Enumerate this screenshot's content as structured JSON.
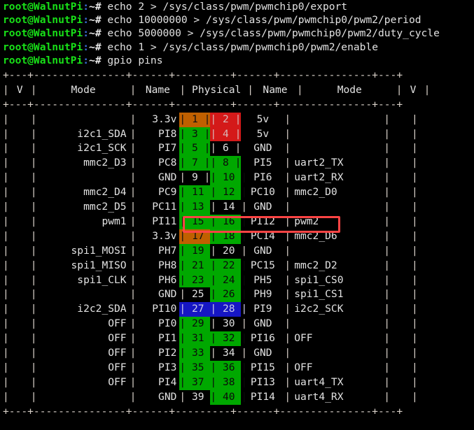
{
  "terminal": {
    "prompt": {
      "user_host": "root@WalnutPi",
      "colon": ":",
      "path": "~",
      "sigil": "#"
    },
    "commands": [
      "echo 2 > /sys/class/pwm/pwmchip0/export",
      "echo 10000000 > /sys/class/pwm/pwmchip0/pwm2/period",
      "echo 5000000 > /sys/class/pwm/pwmchip0/pwm2/duty_cycle",
      "echo 1 > /sys/class/pwm/pwmchip0/pwm2/enable",
      "gpio pins"
    ]
  },
  "gpio_table": {
    "separator": "+---+---------------+------+---------+------+---------------+---+",
    "headers": {
      "v_left": "V",
      "mode_left": "Mode",
      "name_left": "Name",
      "physical": "Physical",
      "name_right": "Name",
      "mode_right": "Mode",
      "v_right": "V"
    },
    "colors": {
      "green": "#00a800",
      "red": "#d41919",
      "orange": "#c06000",
      "blue": "#1616c4",
      "black": "#000000",
      "highlight": "#ff4444"
    },
    "rows": [
      {
        "v_left": "",
        "mode_left": "",
        "name_left": "3.3v",
        "pin_left": "1",
        "pin_left_color": "orange",
        "pin_right": "2",
        "pin_right_color": "red",
        "name_right": "5v",
        "mode_right": "",
        "v_right": ""
      },
      {
        "v_left": "",
        "mode_left": "i2c1_SDA",
        "name_left": "PI8",
        "pin_left": "3",
        "pin_left_color": "green",
        "pin_right": "4",
        "pin_right_color": "red",
        "name_right": "5v",
        "mode_right": "",
        "v_right": ""
      },
      {
        "v_left": "",
        "mode_left": "i2c1_SCK",
        "name_left": "PI7",
        "pin_left": "5",
        "pin_left_color": "green",
        "pin_right": "6",
        "pin_right_color": "black",
        "name_right": "GND",
        "mode_right": "",
        "v_right": ""
      },
      {
        "v_left": "",
        "mode_left": "mmc2_D3",
        "name_left": "PC8",
        "pin_left": "7",
        "pin_left_color": "green",
        "pin_right": "8",
        "pin_right_color": "green",
        "name_right": "PI5",
        "mode_right": "uart2_TX",
        "v_right": ""
      },
      {
        "v_left": "",
        "mode_left": "",
        "name_left": "GND",
        "pin_left": "9",
        "pin_left_color": "black",
        "pin_right": "10",
        "pin_right_color": "green",
        "name_right": "PI6",
        "mode_right": "uart2_RX",
        "v_right": ""
      },
      {
        "v_left": "",
        "mode_left": "mmc2_D4",
        "name_left": "PC9",
        "pin_left": "11",
        "pin_left_color": "green",
        "pin_right": "12",
        "pin_right_color": "green",
        "name_right": "PC10",
        "mode_right": "mmc2_D0",
        "v_right": ""
      },
      {
        "v_left": "",
        "mode_left": "mmc2_D5",
        "name_left": "PC11",
        "pin_left": "13",
        "pin_left_color": "green",
        "pin_right": "14",
        "pin_right_color": "black",
        "name_right": "GND",
        "mode_right": "",
        "v_right": ""
      },
      {
        "v_left": "",
        "mode_left": "pwm1",
        "name_left": "PI11",
        "pin_left": "15",
        "pin_left_color": "green",
        "pin_right": "16",
        "pin_right_color": "green",
        "name_right": "PI12",
        "mode_right": "pwm2",
        "v_right": ""
      },
      {
        "v_left": "",
        "mode_left": "",
        "name_left": "3.3v",
        "pin_left": "17",
        "pin_left_color": "orange",
        "pin_right": "18",
        "pin_right_color": "green",
        "name_right": "PC14",
        "mode_right": "mmc2_D6",
        "v_right": ""
      },
      {
        "v_left": "",
        "mode_left": "spi1_MOSI",
        "name_left": "PH7",
        "pin_left": "19",
        "pin_left_color": "green",
        "pin_right": "20",
        "pin_right_color": "black",
        "name_right": "GND",
        "mode_right": "",
        "v_right": ""
      },
      {
        "v_left": "",
        "mode_left": "spi1_MISO",
        "name_left": "PH8",
        "pin_left": "21",
        "pin_left_color": "green",
        "pin_right": "22",
        "pin_right_color": "green",
        "name_right": "PC15",
        "mode_right": "mmc2_D2",
        "v_right": ""
      },
      {
        "v_left": "",
        "mode_left": "spi1_CLK",
        "name_left": "PH6",
        "pin_left": "23",
        "pin_left_color": "green",
        "pin_right": "24",
        "pin_right_color": "green",
        "name_right": "PH5",
        "mode_right": "spi1_CS0",
        "v_right": ""
      },
      {
        "v_left": "",
        "mode_left": "",
        "name_left": "GND",
        "pin_left": "25",
        "pin_left_color": "black",
        "pin_right": "26",
        "pin_right_color": "green",
        "name_right": "PH9",
        "mode_right": "spi1_CS1",
        "v_right": ""
      },
      {
        "v_left": "",
        "mode_left": "i2c2_SDA",
        "name_left": "PI10",
        "pin_left": "27",
        "pin_left_color": "blue",
        "pin_right": "28",
        "pin_right_color": "blue",
        "name_right": "PI9",
        "mode_right": "i2c2_SCK",
        "v_right": ""
      },
      {
        "v_left": "",
        "mode_left": "OFF",
        "name_left": "PI0",
        "pin_left": "29",
        "pin_left_color": "green",
        "pin_right": "30",
        "pin_right_color": "black",
        "name_right": "GND",
        "mode_right": "",
        "v_right": ""
      },
      {
        "v_left": "",
        "mode_left": "OFF",
        "name_left": "PI1",
        "pin_left": "31",
        "pin_left_color": "green",
        "pin_right": "32",
        "pin_right_color": "green",
        "name_right": "PI16",
        "mode_right": "OFF",
        "v_right": ""
      },
      {
        "v_left": "",
        "mode_left": "OFF",
        "name_left": "PI2",
        "pin_left": "33",
        "pin_left_color": "green",
        "pin_right": "34",
        "pin_right_color": "black",
        "name_right": "GND",
        "mode_right": "",
        "v_right": ""
      },
      {
        "v_left": "",
        "mode_left": "OFF",
        "name_left": "PI3",
        "pin_left": "35",
        "pin_left_color": "green",
        "pin_right": "36",
        "pin_right_color": "green",
        "name_right": "PI15",
        "mode_right": "OFF",
        "v_right": ""
      },
      {
        "v_left": "",
        "mode_left": "OFF",
        "name_left": "PI4",
        "pin_left": "37",
        "pin_left_color": "green",
        "pin_right": "38",
        "pin_right_color": "green",
        "name_right": "PI13",
        "mode_right": "uart4_TX",
        "v_right": ""
      },
      {
        "v_left": "",
        "mode_left": "",
        "name_left": "GND",
        "pin_left": "39",
        "pin_left_color": "black",
        "pin_right": "40",
        "pin_right_color": "green",
        "name_right": "PI14",
        "mode_right": "uart4_RX",
        "v_right": ""
      }
    ],
    "highlighted_row_index": 7
  }
}
